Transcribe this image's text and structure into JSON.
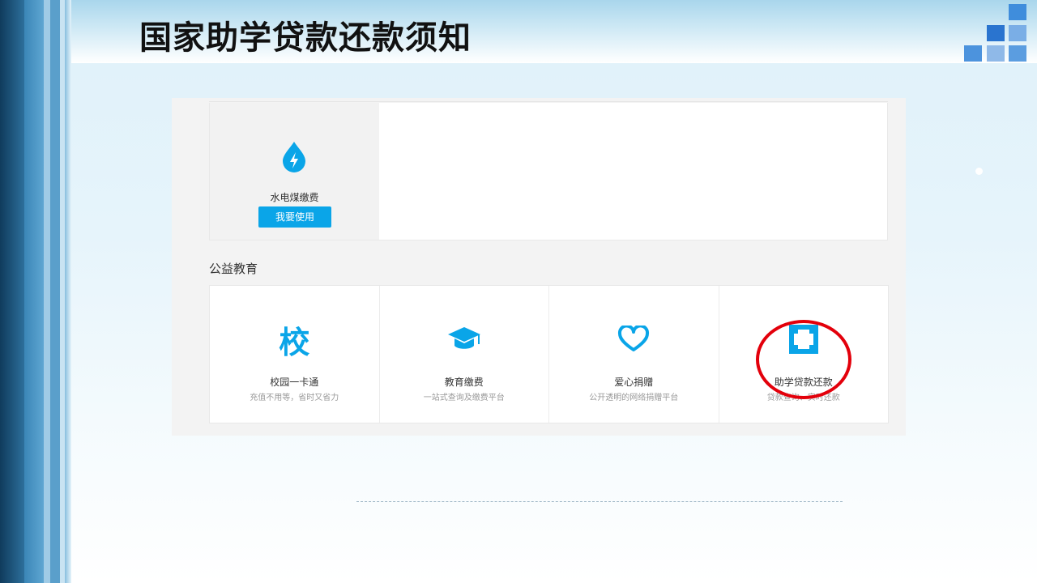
{
  "slide": {
    "title": "国家助学贷款还款须知"
  },
  "top_section": {
    "service": {
      "icon": "water-drop-lightning-icon",
      "label": "水电煤缴费",
      "button_label": "我要使用"
    }
  },
  "education_section": {
    "title": "公益教育",
    "items": [
      {
        "icon": "school-character-icon",
        "icon_glyph": "校",
        "title": "校园一卡通",
        "subtitle": "充值不用等，省时又省力"
      },
      {
        "icon": "graduation-cap-icon",
        "title": "教育缴费",
        "subtitle": "一站式查询及缴费平台"
      },
      {
        "icon": "heart-icon",
        "title": "爱心捐赠",
        "subtitle": "公开透明的网络捐赠平台"
      },
      {
        "icon": "loan-square-icon",
        "title": "助学贷款还款",
        "subtitle": "贷款查询、实时还款"
      }
    ]
  },
  "colors": {
    "accent": "#0aa5e8",
    "highlight_circle": "#e3000b"
  }
}
